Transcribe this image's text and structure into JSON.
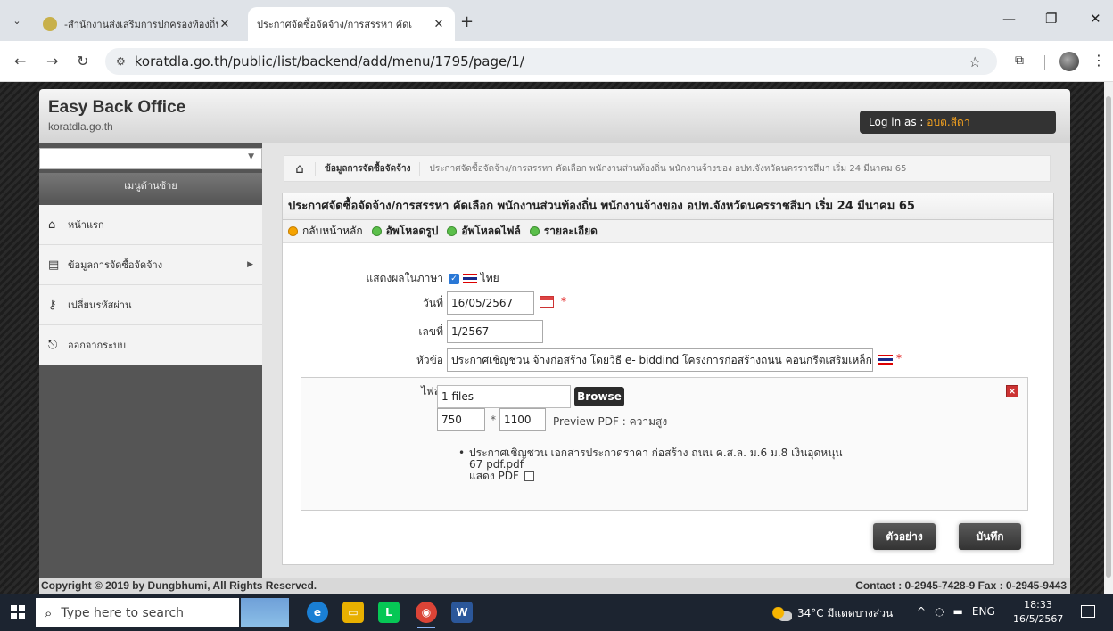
{
  "browser": {
    "tabs": [
      {
        "label": "-สำนักงานส่งเสริมการปกครองท้องถิ่น",
        "active": false
      },
      {
        "label": "ประกาศจัดซื้อจัดจ้าง/การสรรหา คัดเ",
        "active": true
      }
    ],
    "url": "koratdla.go.th/public/list/backend/add/menu/1795/page/1/"
  },
  "header": {
    "title": "Easy Back Office",
    "subtitle": "koratdla.go.th",
    "login_prefix": "Log in as : ",
    "login_user": "อบต.สีดา"
  },
  "sidebar": {
    "heading": "เมนูด้านซ้าย",
    "items": [
      {
        "label": "หน้าแรก",
        "icon": "home-icon"
      },
      {
        "label": "ข้อมูลการจัดซื้อจัดจ้าง",
        "icon": "document-icon"
      },
      {
        "label": "เปลี่ยนรหัสผ่าน",
        "icon": "key-icon"
      },
      {
        "label": "ออกจากระบบ",
        "icon": "logout-icon"
      }
    ]
  },
  "breadcrumb": {
    "section": "ข้อมูลการจัดซื้อจัดจ้าง",
    "current": "ประกาศจัดซื้อจัดจ้าง/การสรรหา คัดเลือก พนักงานส่วนท้องถิ่น พนักงานจ้างของ อปท.จังหวัดนครราชสีมา เริ่ม 24 มีนาคม 65"
  },
  "panel": {
    "title": "ประกาศจัดซื้อจัดจ้าง/การสรรหา คัดเลือก พนักงานส่วนท้องถิ่น พนักงานจ้างของ อปท.จังหวัดนครราชสีมา เริ่ม 24 มีนาคม 65",
    "tools": [
      "กลับหน้าหลัก",
      "อัพโหลดรูป",
      "อัพโหลดไฟล์",
      "รายละเอียด"
    ]
  },
  "form": {
    "language_label": "แสดงผลในภาษา",
    "language_value": "ไทย",
    "date_label": "วันที่",
    "date_value": "16/05/2567",
    "number_label": "เลขที่",
    "number_value": "1/2567",
    "subject_label": "หัวข้อ",
    "subject_value": "ประกาศเชิญชวน จ้างก่อสร้าง โดยวิธี e- biddind โครงการก่อสร้างถนน คอนกรีตเสริมเหล็ก",
    "required_mark": "*"
  },
  "file": {
    "label": "ไฟล์",
    "value": "1 files",
    "browse": "Browse",
    "width": "750",
    "times": "*",
    "height": "1100",
    "preview_label": "Preview PDF : ความสูง",
    "file_name_line1": "ประกาศเชิญชวน เอกสารประกวดราคา ก่อสร้าง ถนน ค.ส.ล. ม.6 ม.8 เงินอุดหนุน",
    "file_name_line2": "67 pdf.pdf",
    "show_pdf": "แสดง PDF",
    "close": "×"
  },
  "actions": {
    "preview": "ตัวอย่าง",
    "save": "บันทึก"
  },
  "footer": {
    "copyright": "Copyright © 2019 by Dungbhumi, All Rights Reserved.",
    "contact": "Contact : 0-2945-7428-9 Fax : 0-2945-9443"
  },
  "taskbar": {
    "search_placeholder": "Type here to search",
    "weather": "34°C มีแดดบางส่วน",
    "lang": "ENG",
    "time": "18:33",
    "date": "16/5/2567"
  }
}
